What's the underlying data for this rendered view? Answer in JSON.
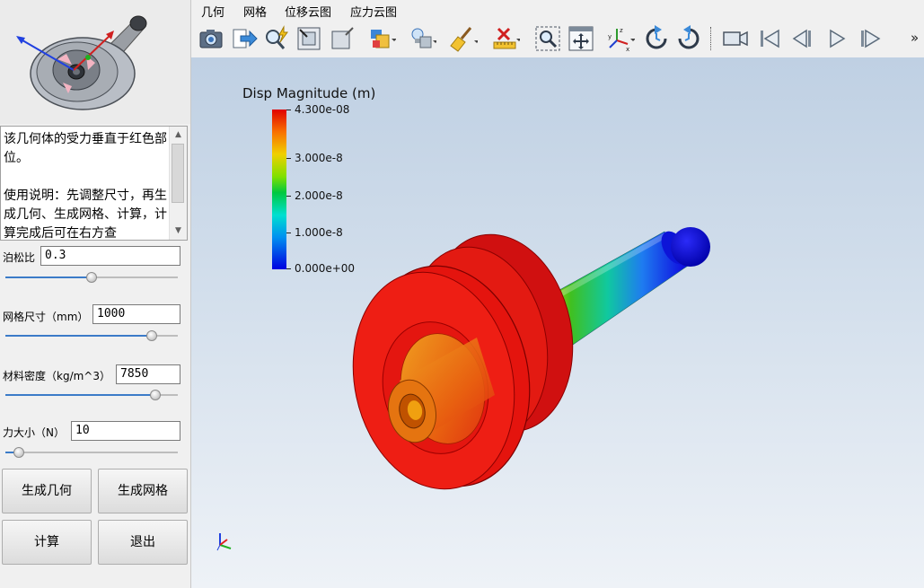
{
  "menubar": {
    "items": [
      "几何",
      "网格",
      "位移云图",
      "应力云图"
    ]
  },
  "toolbar": {
    "icons": [
      "camera-icon",
      "export-arrow-icon",
      "zoom-lightning-icon",
      "zoom-extents-icon",
      "select-box-icon",
      "shading-cube-icon",
      "light-bulb-icon",
      "clear-brush-icon",
      "delete-measure-icon",
      "zoom-window-icon",
      "fit-all-icon",
      "axes-triad-icon",
      "rotate-left-icon",
      "rotate-right-icon",
      "record-video-icon",
      "first-frame-icon",
      "previous-frame-icon",
      "play-icon",
      "next-frame-icon",
      "more-chevron-icon"
    ],
    "overflow_label": "»"
  },
  "left_panel": {
    "description": "该几何体的受力垂直于红色部位。\n\n使用说明：先调整尺寸，再生成几何、生成网格、计算，计算完成后可在右方查",
    "params": [
      {
        "label": "泊松比",
        "value": "0.3",
        "slider_fraction": 0.5
      },
      {
        "label": "网格尺寸（mm）",
        "value": "1000",
        "slider_fraction": 0.85
      },
      {
        "label": "材料密度（kg/m^3）",
        "value": "7850",
        "slider_fraction": 0.87
      },
      {
        "label": "力大小（N）",
        "value": "10",
        "slider_fraction": 0.08
      }
    ],
    "buttons": {
      "generate_geometry": "生成几何",
      "generate_mesh": "生成网格",
      "compute": "计算",
      "exit": "退出"
    }
  },
  "viewport": {
    "legend": {
      "title": "Disp Magnitude (m)",
      "ticks": [
        "4.300e-08",
        "3.000e-8",
        "2.000e-8",
        "1.000e-8",
        "0.000e+00"
      ],
      "colors": [
        "#e00000",
        "#f87000",
        "#f0d000",
        "#80e000",
        "#00c840",
        "#00e0d0",
        "#0090f0",
        "#0000e0"
      ]
    },
    "axes": {
      "x_color": "#e02020",
      "y_color": "#20b020",
      "z_color": "#2040e0"
    }
  }
}
